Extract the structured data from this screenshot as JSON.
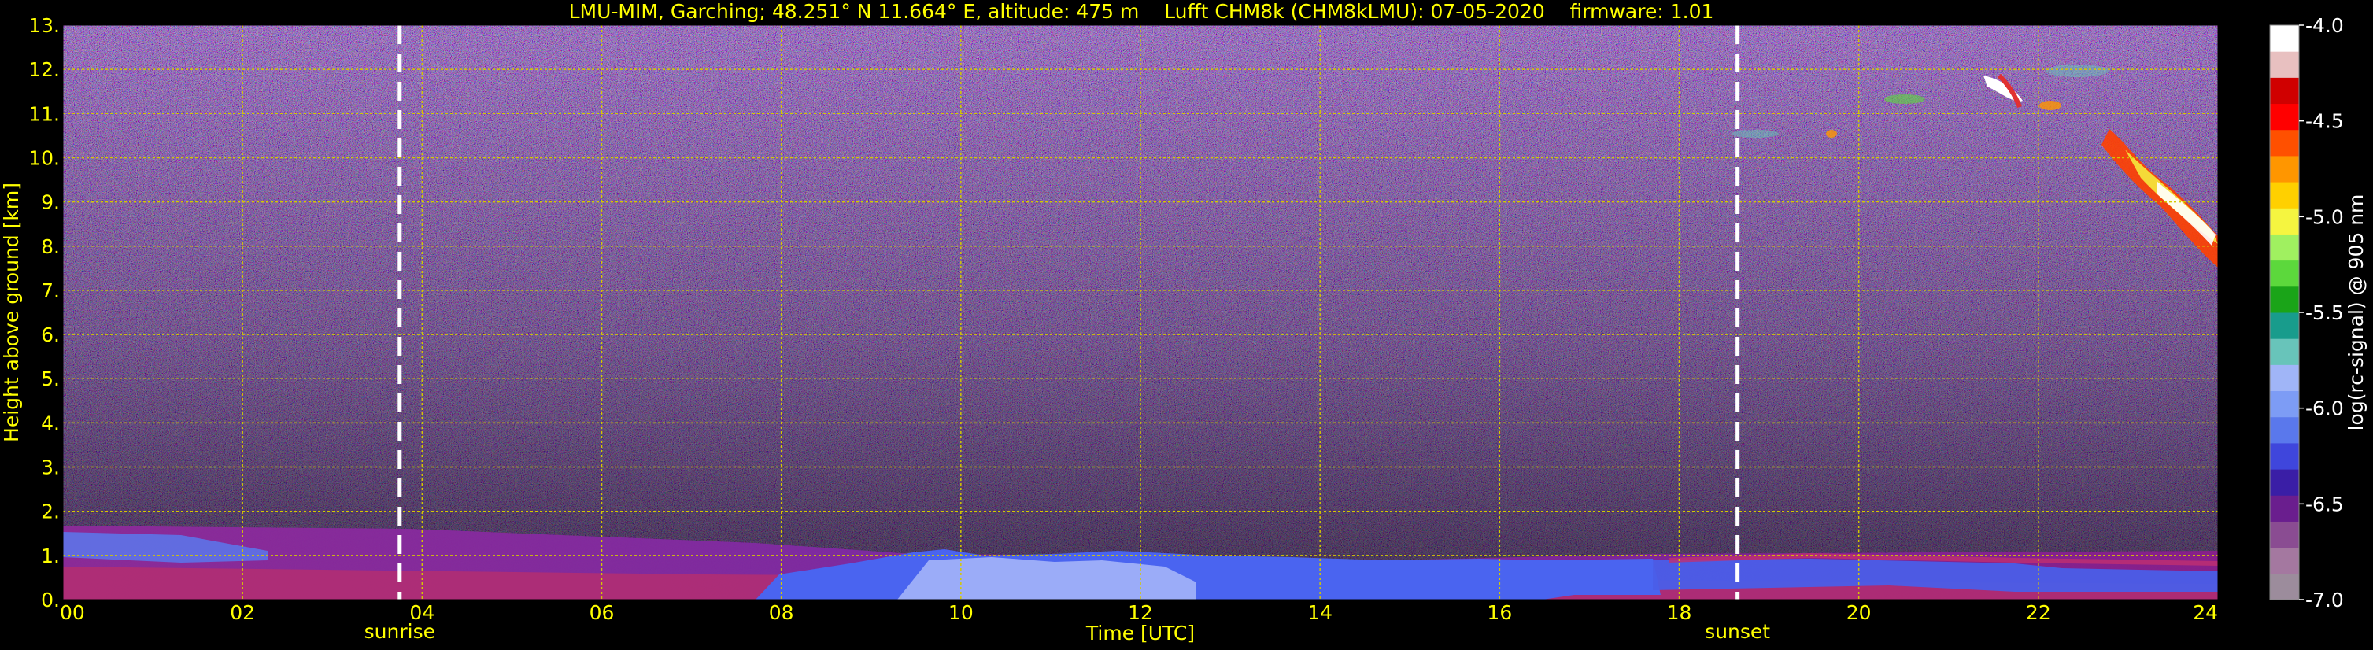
{
  "chart_data": {
    "type": "heatmap",
    "title": "LMU-MIM, Garching; 48.251° N 11.664° E, altitude: 475 m    Lufft CHM8k (CHM8kLMU): 07-05-2020    firmware: 1.01",
    "xlabel": "Time [UTC]",
    "ylabel": "Height above ground [km]",
    "colorbar_label": "log(rc-signal) @ 905 nm",
    "xlim": [
      0,
      24
    ],
    "ylim": [
      0,
      13
    ],
    "clim": [
      -7.0,
      -4.0
    ],
    "x_ticks": [
      "00",
      "02",
      "04",
      "06",
      "08",
      "10",
      "12",
      "14",
      "16",
      "18",
      "20",
      "22",
      "24"
    ],
    "y_ticks": [
      "0.",
      "1.",
      "2.",
      "3.",
      "4.",
      "5.",
      "6.",
      "7.",
      "8.",
      "9.",
      "10.",
      "11.",
      "12.",
      "13."
    ],
    "colorbar_ticks": [
      "-4.0",
      "-4.5",
      "-5.0",
      "-5.5",
      "-6.0",
      "-6.5",
      "-7.0"
    ],
    "grid": true,
    "annotations": [
      {
        "x": 3.75,
        "label": "sunrise"
      },
      {
        "x": 18.65,
        "label": "sunset"
      }
    ],
    "colors": {
      "background": "#000000",
      "axis_text": "#ffff00",
      "grid": "#d4c800",
      "marker_line": "#ffffff",
      "colorbar": [
        "#9c8c9c",
        "#a478a0",
        "#8a4c92",
        "#6a1e8e",
        "#3a1ea6",
        "#3f46dc",
        "#5a78ec",
        "#7d9cf5",
        "#a0b5f7",
        "#68c4ba",
        "#189c8c",
        "#1aa418",
        "#5cd83c",
        "#a0f060",
        "#f5f540",
        "#ffd000",
        "#ff9600",
        "#ff5000",
        "#ff0000",
        "#d00000",
        "#e8c0c0",
        "#ffffff"
      ]
    }
  }
}
